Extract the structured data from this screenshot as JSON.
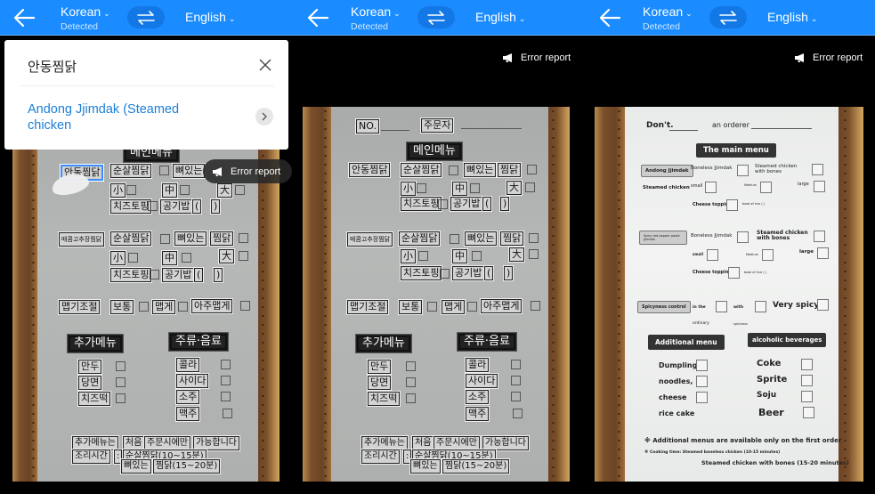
{
  "header": {
    "source_language": "Korean",
    "source_status": "Detected",
    "target_language": "English",
    "icons": {
      "back": "arrow-left-icon",
      "swap": "swap-arrows-icon",
      "dropdown": "chevron-down-icon"
    }
  },
  "error_report": {
    "label": "Error report",
    "icon": "megaphone-icon"
  },
  "translation_card": {
    "source_text": "안동찜닭",
    "translated_text": "Andong Jjimdak (Steamed chicken",
    "icons": {
      "close": "close-icon",
      "more": "chevron-right-icon"
    }
  },
  "korean_menu": {
    "no_label": "NO.",
    "orderer_label": "주문자",
    "main_menu_header": "메인메뉴",
    "item1": "안동찜닭",
    "boneless": "순살찜닭",
    "bone_in_a": "뼈있는",
    "bone_in_b": "찜닭",
    "small": "小",
    "medium": "中",
    "large": "大",
    "cheese_topping": "치즈토핑",
    "rice": "공기밥",
    "bracket_open": "(",
    "bracket_close": ")",
    "item2": "매콤고추장찜닭",
    "spice_control": "맵기조절",
    "normal": "보통",
    "spicy": "맵게",
    "very_spicy": "아주맵게",
    "additional_header": "추가메뉴",
    "drinks_header": "주류·음료",
    "additional_items": [
      "만두",
      "당면",
      "치즈떡"
    ],
    "drink_items": [
      "콜라",
      "사이다",
      "소주",
      "맥주"
    ],
    "note1": [
      "추가메뉴는",
      "처음",
      "주문시에만",
      "가능합니다"
    ],
    "note2_label": "조리시간",
    "note2_colon": ":",
    "note2_a": "순살찜닭(10~15분)",
    "note2_b1": "뼈있는",
    "note2_b2": "찜닭(15~20분)"
  },
  "english_menu": {
    "dont": "Don't.",
    "orderer": "an orderer",
    "main_menu_header": "The main menu",
    "item1": "Andong Jjimdak",
    "item1_sub": "Steamed chicken",
    "boneless": "Boneless Jjimdak",
    "bone_in": "Steamed chicken with bones",
    "small": "small",
    "medium": "Medium",
    "large": "large",
    "cheese_topping": "Cheese topping",
    "rice": "bowl of rice ( )",
    "item2": "Spicy red pepper paste Jjimdak",
    "spice_control": "Spicyness control",
    "in_the": "in the",
    "ordinary": "ordinary",
    "with": "with",
    "spiciness": "spiciness",
    "very_spicy": "Very spicy",
    "additional_header": "Additional menu",
    "drinks_header": "alcoholic beverages",
    "additional_items": [
      "Dumpling",
      "noodles,",
      "cheese",
      "rice cake"
    ],
    "drink_items": [
      "Coke",
      "Sprite",
      "Soju",
      "Beer"
    ],
    "note1": "※ Additional menus are available only on the first order",
    "note2": "※ Cooking time: Steamed boneless chicken (10-15 minutes)",
    "note3": "Steamed chicken with bones (15-20 minutes)"
  }
}
